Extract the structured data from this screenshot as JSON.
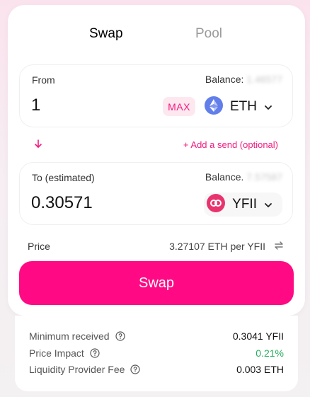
{
  "tabs": {
    "swap": "Swap",
    "pool": "Pool"
  },
  "from": {
    "label": "From",
    "balance_label": "Balance:",
    "balance_value": "1.46577",
    "amount": "1",
    "max_label": "MAX",
    "token": "ETH"
  },
  "add_send": "+ Add a send (optional)",
  "to": {
    "label": "To (estimated)",
    "balance_label": "Balance.",
    "balance_value": "7.57587",
    "amount": "0.30571",
    "token": "YFII"
  },
  "price": {
    "label": "Price",
    "value": "3.27107 ETH per YFII"
  },
  "swap_button": "Swap",
  "details": {
    "min_received": {
      "label": "Minimum received",
      "value": "0.3041 YFII"
    },
    "price_impact": {
      "label": "Price Impact",
      "value": "0.21%"
    },
    "lp_fee": {
      "label": "Liquidity Provider Fee",
      "value": "0.003 ETH"
    }
  },
  "colors": {
    "accent": "#ff0a84",
    "accent_text": "#f01a7f",
    "positive": "#27ae60"
  },
  "icons": {
    "eth": "ethereum-icon",
    "yfii": "yfii-icon",
    "chevron": "chevron-down-icon",
    "arrow": "arrow-down-icon",
    "refresh": "swap-arrows-icon",
    "help": "question-circle-icon"
  }
}
